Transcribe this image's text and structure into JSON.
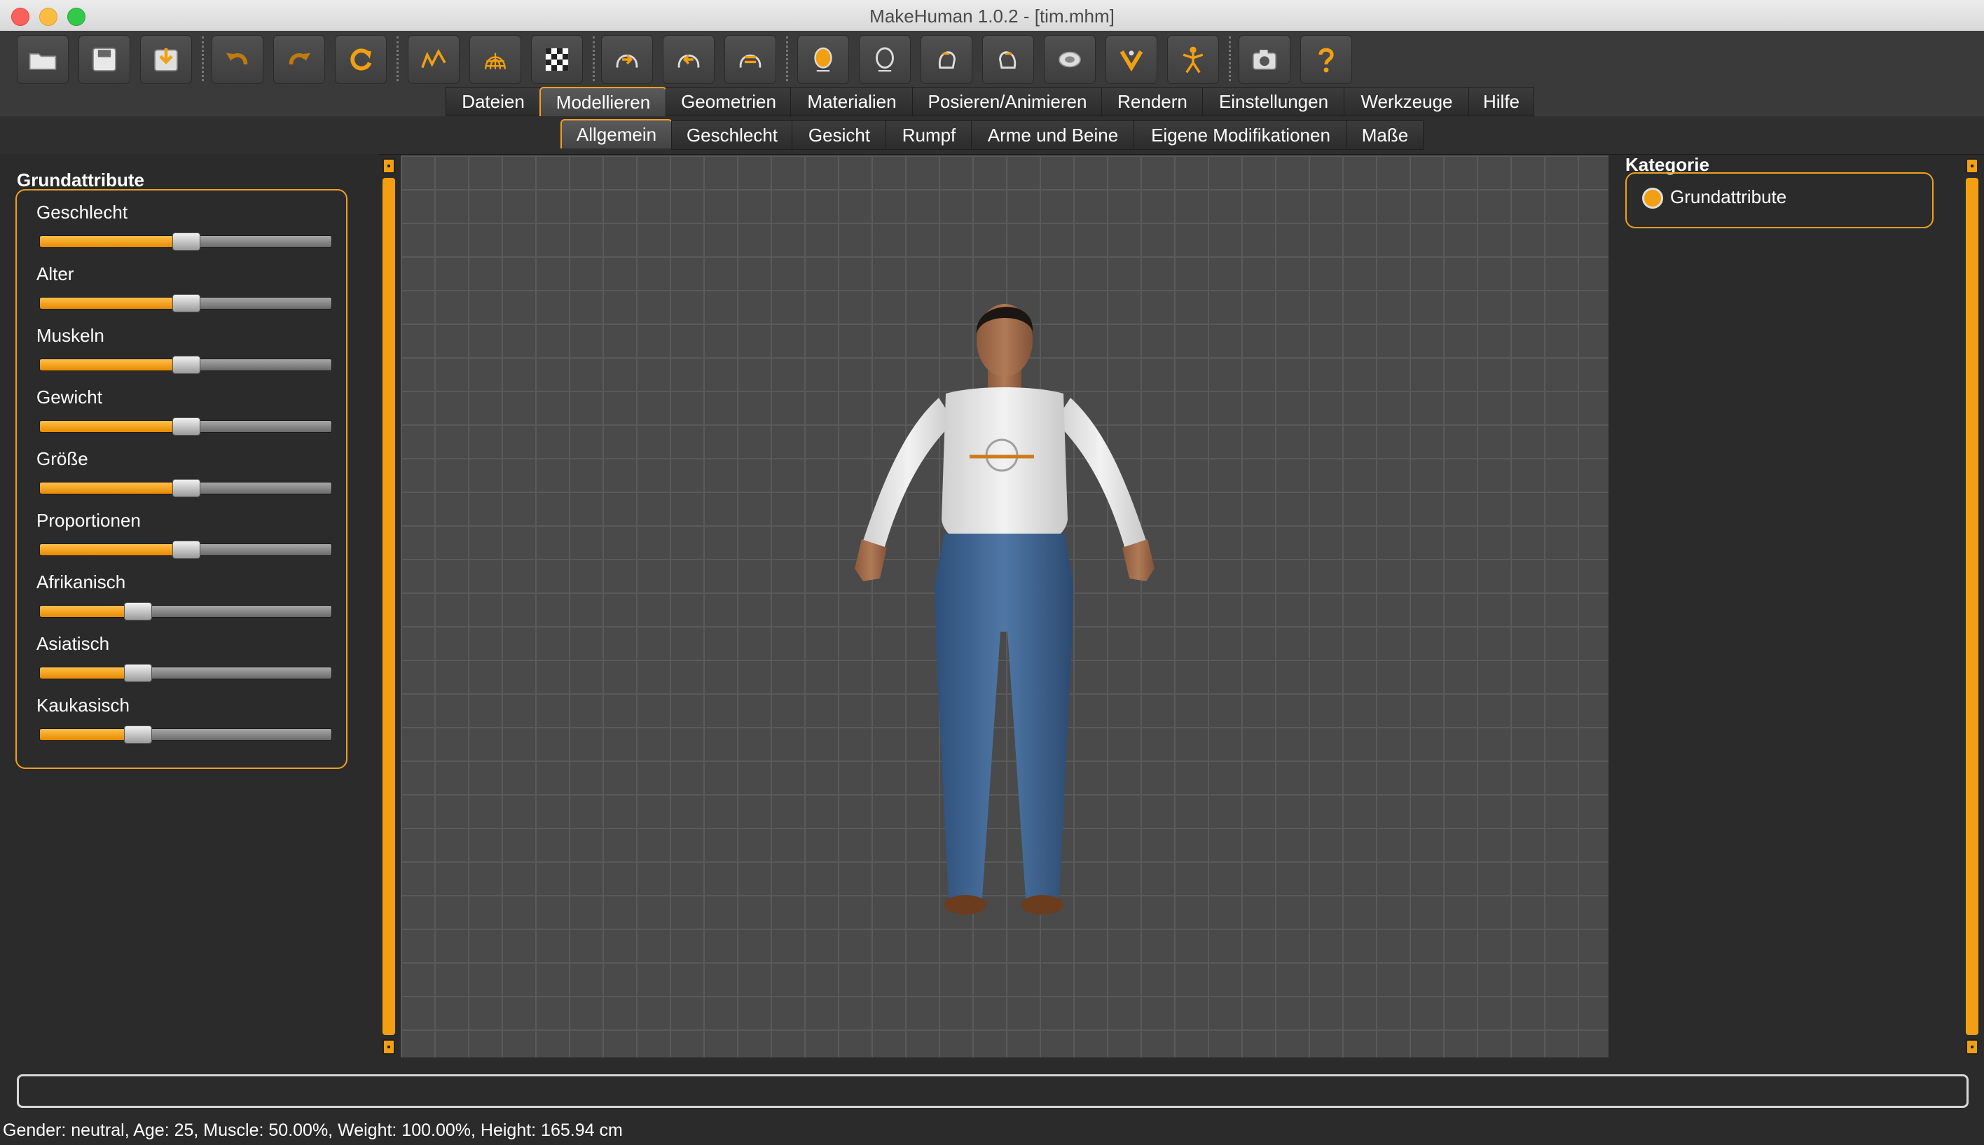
{
  "window": {
    "title": "MakeHuman 1.0.2 - [tim.mhm]",
    "traffic_lights": [
      "close",
      "minimize",
      "zoom"
    ]
  },
  "toolbar": {
    "buttons": [
      {
        "icon": "open-folder-icon",
        "label": "Öffnen"
      },
      {
        "icon": "save-icon",
        "label": "Speichern"
      },
      {
        "icon": "export-icon",
        "label": "Exportieren"
      },
      {
        "icon": "undo-icon",
        "label": "Rückgängig"
      },
      {
        "icon": "redo-icon",
        "label": "Wiederholen"
      },
      {
        "icon": "reset-icon",
        "label": "Zurücksetzen"
      },
      {
        "icon": "smooth-icon",
        "label": "Glätten"
      },
      {
        "icon": "wireframe-icon",
        "label": "Drahtgitter"
      },
      {
        "icon": "background-checker-icon",
        "label": "Hintergrund"
      },
      {
        "icon": "front-view-icon",
        "label": "Vorderansicht"
      },
      {
        "icon": "back-view-icon",
        "label": "Rückansicht"
      },
      {
        "icon": "side-view-icon",
        "label": "Seitenansicht"
      },
      {
        "icon": "head-front-icon",
        "label": "Kopf vorne"
      },
      {
        "icon": "head-back-icon",
        "label": "Kopf hinten"
      },
      {
        "icon": "head-left-icon",
        "label": "Kopf links"
      },
      {
        "icon": "head-right-icon",
        "label": "Kopf rechts"
      },
      {
        "icon": "top-view-icon",
        "label": "Draufsicht"
      },
      {
        "icon": "bottom-view-icon",
        "label": "Untersicht"
      },
      {
        "icon": "pose-figure-icon",
        "label": "Pose"
      },
      {
        "icon": "camera-icon",
        "label": "Bildschirmfoto"
      },
      {
        "icon": "help-icon",
        "label": "Hilfe"
      }
    ]
  },
  "menu": {
    "tabs": [
      "Dateien",
      "Modellieren",
      "Geometrien",
      "Materialien",
      "Posieren/Animieren",
      "Rendern",
      "Einstellungen",
      "Werkzeuge",
      "Hilfe"
    ],
    "active": "Modellieren"
  },
  "subtabs": {
    "tabs": [
      "Allgemein",
      "Geschlecht",
      "Gesicht",
      "Rumpf",
      "Arme und Beine",
      "Eigene Modifikationen",
      "Maße"
    ],
    "active": "Allgemein"
  },
  "left_panel": {
    "title": "Grundattribute",
    "sliders": [
      {
        "label": "Geschlecht",
        "value": 0.5
      },
      {
        "label": "Alter",
        "value": 0.5
      },
      {
        "label": "Muskeln",
        "value": 0.5
      },
      {
        "label": "Gewicht",
        "value": 0.5
      },
      {
        "label": "Größe",
        "value": 0.5
      },
      {
        "label": "Proportionen",
        "value": 0.5
      },
      {
        "label": "Afrikanisch",
        "value": 0.333
      },
      {
        "label": "Asiatisch",
        "value": 0.333
      },
      {
        "label": "Kaukasisch",
        "value": 0.333
      }
    ]
  },
  "right_panel": {
    "title": "Kategorie",
    "options": [
      {
        "label": "Grundattribute",
        "selected": true
      }
    ]
  },
  "status": {
    "text": "Gender: neutral, Age: 25, Muscle: 50.00%, Weight: 100.00%, Height: 165.94 cm"
  },
  "colors": {
    "accent": "#f2a011",
    "background": "#2b2b2b",
    "viewport": "#4a4a4a",
    "grid": "#5a5a5a"
  }
}
